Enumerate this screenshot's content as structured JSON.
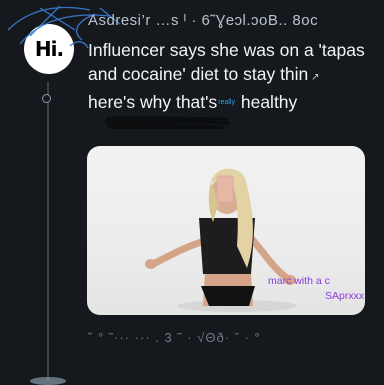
{
  "avatar": {
    "text": "Hi."
  },
  "header": {
    "text": "Asdresi’r …s ᴵ · 6˜Ɣeɔl.ɔoB.. 8oc"
  },
  "tweet": {
    "lines": [
      "Influencer says she was on a 'tapas",
      "and cocaine' diet to stay thin",
      "here's why that's",
      "healthy"
    ],
    "insert": "really"
  },
  "media": {
    "captions": [
      "marc with a c",
      "SAprxxx"
    ]
  },
  "actions": {
    "text": "˘ ° ˜···  ··· . 3  ˜ · √Θð· ˇ · °"
  },
  "colors": {
    "background": "#15181c",
    "caption": "#8a3bd6",
    "accent": "#29a3ef"
  }
}
